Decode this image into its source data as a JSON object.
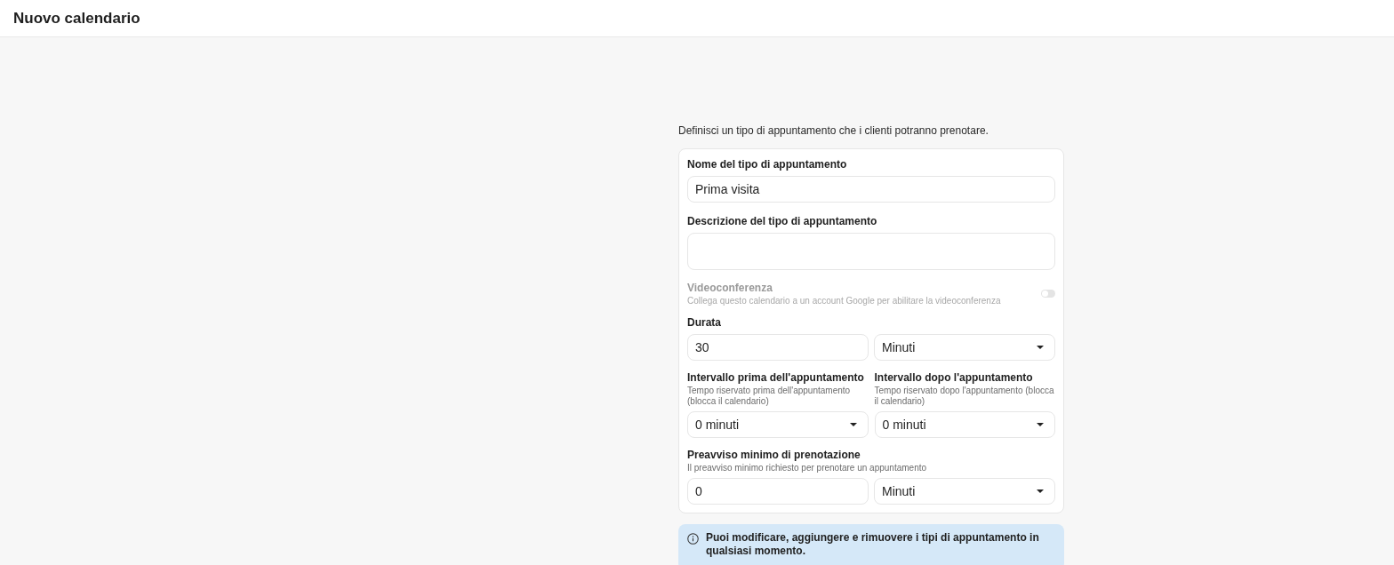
{
  "header": {
    "title": "Nuovo calendario"
  },
  "intro": "Definisci un tipo di appuntamento che i clienti potranno prenotare.",
  "form": {
    "name_field": {
      "label": "Nome del tipo di appuntamento",
      "value": "Prima visita"
    },
    "description_field": {
      "label": "Descrizione del tipo di appuntamento"
    },
    "videoconference": {
      "label": "Videoconferenza",
      "hint": "Collega questo calendario a un account Google per abilitare la videoconferenza",
      "disabled": true,
      "on": false
    },
    "duration": {
      "label": "Durata",
      "value": "30",
      "unit": "Minuti"
    },
    "buffers": [
      {
        "label": "Intervallo prima dell'appuntamento",
        "hint": "Tempo riservato prima dell'appuntamento (blocca il calendario)",
        "value": "0 minuti"
      },
      {
        "label": "Intervallo dopo l'appuntamento",
        "hint": "Tempo riservato dopo l'appuntamento (blocca il calendario)",
        "value": "0 minuti"
      }
    ],
    "minimum_notice": {
      "label": "Preavviso minimo di prenotazione",
      "hint": "Il preavviso minimo richiesto per prenotare un appuntamento",
      "value": "0",
      "unit": "Minuti"
    }
  },
  "info_banner": {
    "text": "Puoi modificare, aggiungere e rimuovere i tipi di appuntamento in qualsiasi momento."
  }
}
